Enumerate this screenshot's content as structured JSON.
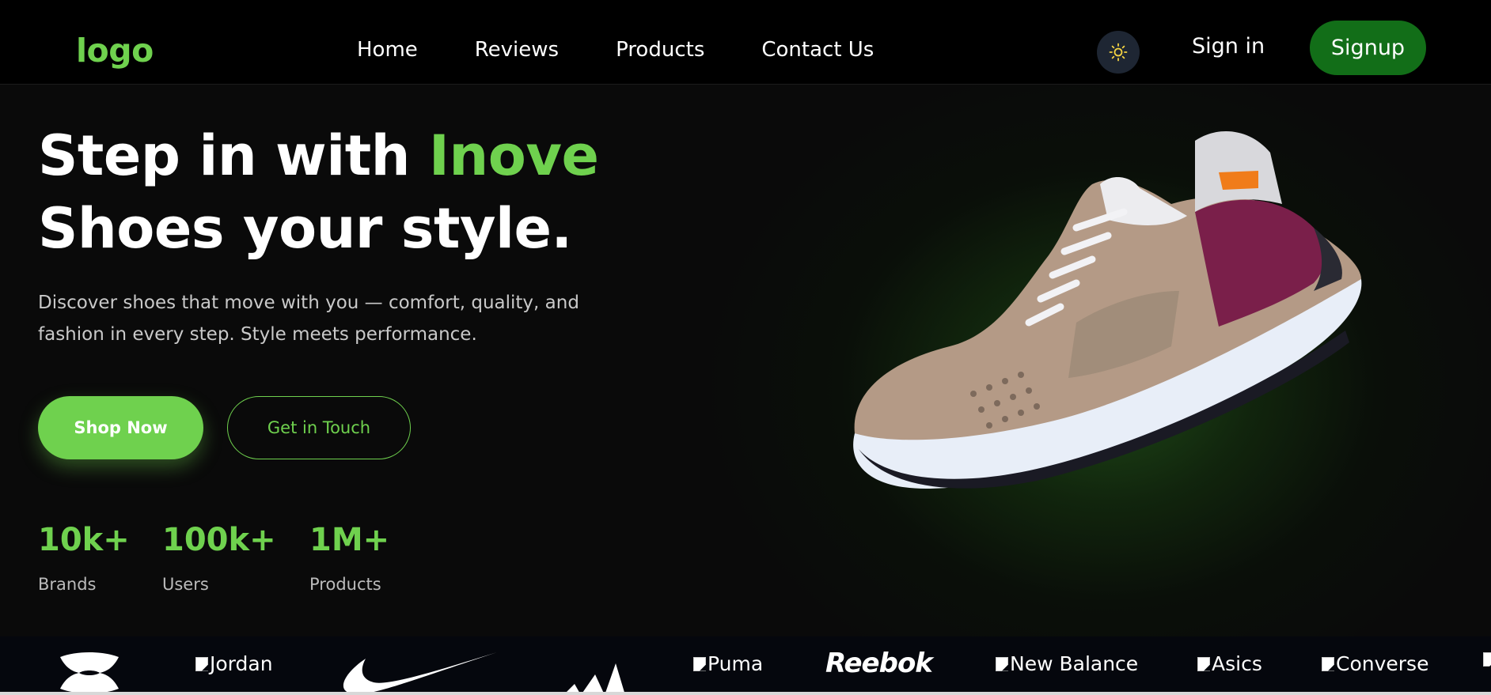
{
  "nav": {
    "logo": "logo",
    "links": [
      "Home",
      "Reviews",
      "Products",
      "Contact Us"
    ],
    "theme_icon": "sun-icon",
    "signin": "Sign in",
    "signup": "Signup"
  },
  "hero": {
    "headline_part1": "Step in with ",
    "headline_accent": "Inove",
    "headline_line2": "Shoes your style.",
    "description": "Discover shoes that move with you — comfort, quality, and fashion in every step. Style meets performance.",
    "shop_now": "Shop Now",
    "get_in_touch": "Get in Touch",
    "stats": [
      {
        "value": "10k+",
        "label": "Brands"
      },
      {
        "value": "100k+",
        "label": "Users"
      },
      {
        "value": "1M+",
        "label": "Products"
      }
    ]
  },
  "brands": {
    "jordan": "Jordan",
    "reebok": "Reebok",
    "puma": "Puma",
    "new_balance": "New Balance",
    "asics": "Asics",
    "converse": "Converse"
  },
  "colors": {
    "accent": "#6fd14e",
    "signup_bg": "#126e18",
    "background": "#0a0a0a"
  }
}
